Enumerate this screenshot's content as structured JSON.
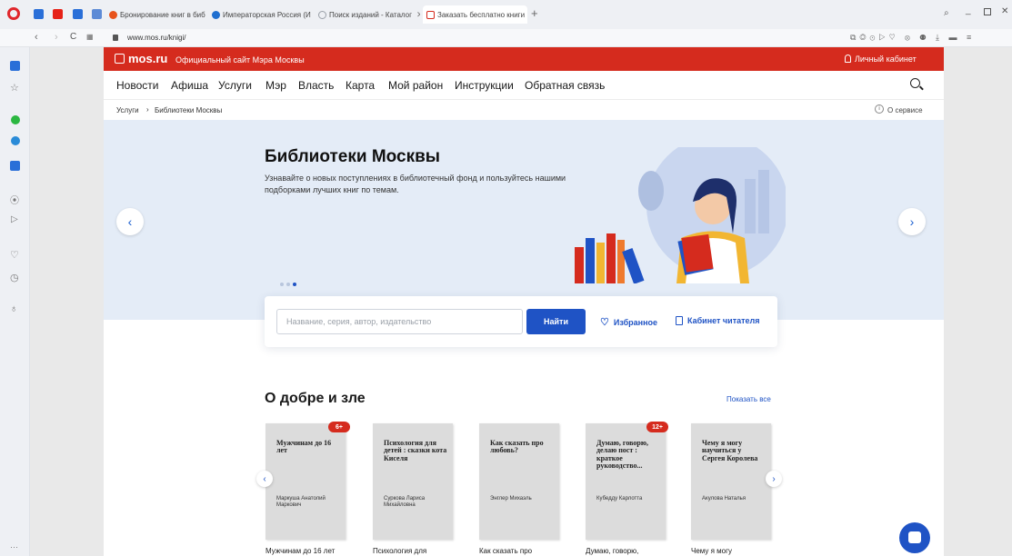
{
  "browser": {
    "tabs": [
      {
        "label": "Бронирование книг в биб",
        "color": "#e8531c"
      },
      {
        "label": "Императорская Россия (И",
        "color": "#1f6fd0"
      },
      {
        "label": "Поиск изданий - Каталог",
        "color": "#9aa0a8"
      },
      {
        "label": "Заказать бесплатно книги",
        "color": "#d52b1e"
      }
    ],
    "new_tab": "+",
    "url": "www.mos.ru/knigi/"
  },
  "site": {
    "brand": "mos.ru",
    "brand_tagline": "Официальный сайт Мэра Москвы",
    "account": "Личный кабинет",
    "nav": [
      "Новости",
      "Афиша",
      "Услуги",
      "Мэр",
      "Власть",
      "Карта",
      "Мой район",
      "Инструкции",
      "Обратная связь"
    ],
    "breadcrumb": [
      "Услуги",
      "Библиотеки Москвы"
    ],
    "about_service": "О сервисе",
    "hero": {
      "title": "Библиотеки Москвы",
      "text": "Узнавайте о новых поступлениях в библиотечный фонд и пользуйтесь нашими подборками лучших книг по темам."
    },
    "search": {
      "placeholder": "Название, серия, автор, издательство",
      "button": "Найти",
      "favorites": "Избранное",
      "cabinet": "Кабинет читателя"
    },
    "section": {
      "title": "О добре и зле",
      "show_all": "Показать все",
      "books": [
        {
          "title": "Мужчинам до 16 лет",
          "author": "Маркуша Анатолий Маркович",
          "age": "6+",
          "caption": "Мужчинам до 16 лет"
        },
        {
          "title": "Психология для детей : сказки кота Киселя",
          "author": "Суркова Лариса Михайловна",
          "age": "",
          "caption": "Психология для"
        },
        {
          "title": "Как сказать про любовь?",
          "author": "Энглер Михаэль",
          "age": "",
          "caption": "Как сказать про"
        },
        {
          "title": "Думаю, говорю, делаю пост : краткое руководство...",
          "author": "Кубедду Карлотта",
          "age": "12+",
          "caption": "Думаю, говорю,"
        },
        {
          "title": "Чему я могу научиться у Сергея Королева",
          "author": "Акулова Наталья",
          "age": "",
          "caption": "Чему я могу"
        }
      ]
    }
  },
  "colors": {
    "brand_red": "#d52b1e",
    "accent_blue": "#1f53c5",
    "hero_bg": "#e4ecf7"
  }
}
